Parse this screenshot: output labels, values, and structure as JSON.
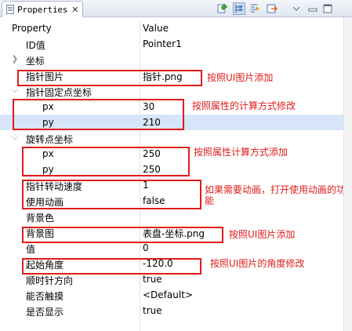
{
  "tab": {
    "title": "Properties",
    "close": "✕"
  },
  "toolbar": [
    "pin-icon",
    "categories-icon",
    "filter-icon",
    "restore-icon",
    "view-menu-icon",
    "minimize-icon",
    "maximize-icon"
  ],
  "header": {
    "property": "Property",
    "value": "Value"
  },
  "rows": [
    {
      "name": "ID值",
      "value": "Pointer1"
    },
    {
      "name": "坐标",
      "value": ""
    },
    {
      "name": "指针图片",
      "value": "指针.png"
    },
    {
      "name": "指针固定点坐标",
      "value": ""
    },
    {
      "name": "px",
      "value": "30"
    },
    {
      "name": "py",
      "value": "210"
    },
    {
      "name": "旋转点坐标",
      "value": ""
    },
    {
      "name": "px",
      "value": "250"
    },
    {
      "name": "py",
      "value": "250"
    },
    {
      "name": "指针转动速度",
      "value": "1"
    },
    {
      "name": "使用动画",
      "value": "false"
    },
    {
      "name": "背景色",
      "value": ""
    },
    {
      "name": "背景图",
      "value": "表盘-坐标.png"
    },
    {
      "name": "值",
      "value": "0"
    },
    {
      "name": "起始角度",
      "value": "-120.0"
    },
    {
      "name": "顺时针方向",
      "value": "true"
    },
    {
      "name": "能否触摸",
      "value": "<Default>"
    },
    {
      "name": "是否显示",
      "value": "true"
    }
  ],
  "notes": [
    "按照UI图片添加",
    "按照属性的计算方式修改",
    "按照属性计算方式添加",
    "如果需要动画，打开使用动画的功能",
    "按照UI图片添加",
    "按照UI图片的角度修改"
  ],
  "colors": {
    "annotation": "#e01b1b",
    "selection": "#d6e6f8"
  }
}
